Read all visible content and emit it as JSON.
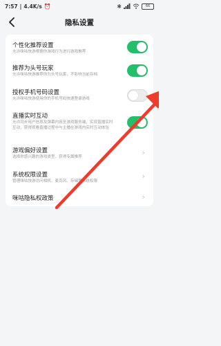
{
  "status_bar": {
    "time": "7:57",
    "speed": "4.4K/s",
    "icons": [
      "alarm-icon",
      "bluetooth-icon",
      "signal-icon",
      "wifi-icon"
    ],
    "battery": "66"
  },
  "header": {
    "title": "隐私设置"
  },
  "settings": [
    {
      "title": "个性化推荐设置",
      "desc": "允许咪咕快游根据你游戏行为进行游戏推荐",
      "control": "toggle",
      "on": true
    },
    {
      "title": "推荐为头号玩家",
      "desc": "允许咪咕快游推荐你为头号玩家，不影响当前存档",
      "control": "toggle",
      "on": true
    },
    {
      "title": "授权手机号码设置",
      "desc": "允许咪咕快游使用你的手机号码快速登录游戏",
      "control": "toggle",
      "on": false
    },
    {
      "title": "直播实时互动",
      "desc": "允许同步用户信息及弹幕内容至游戏服务端，实现直播实时互动，获得观看直播过程中与主播在游戏内实时互动体验",
      "control": "toggle",
      "on": true
    },
    {
      "title": "游戏偏好设置",
      "desc": "选择你感兴趣的游戏类型，获得专属推荐",
      "control": "link"
    },
    {
      "title": "系统权限设置",
      "desc": "管理咪咕快游访问相机、麦克风、存储等系统权限",
      "control": "link"
    },
    {
      "title": "咪咕隐私权政策",
      "desc": "",
      "control": "link"
    }
  ],
  "colors": {
    "toggle_on": "#22c06a",
    "annotation_arrow": "#ee3b2b"
  }
}
